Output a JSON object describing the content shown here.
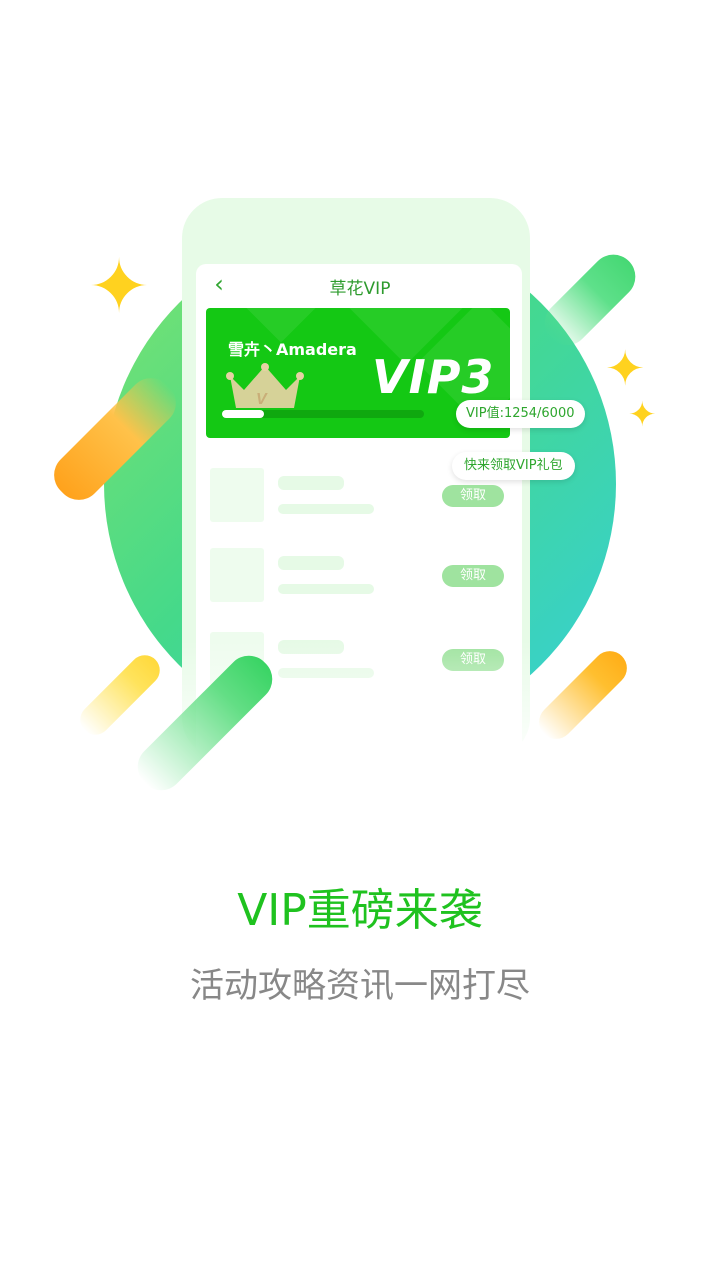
{
  "card": {
    "nav_title": "草花VIP",
    "username": "雪卉丶Amadera",
    "vip_level": "VIP3",
    "vip_value_label": "VIP值:1254/6000",
    "vip_progress": 0.21,
    "gift_prompt": "快来领取VIP礼包"
  },
  "list": {
    "claim_labels": [
      "领取",
      "领取",
      "领取"
    ]
  },
  "promo": {
    "headline": "VIP重磅来袭",
    "subline": "活动攻略资讯一网打尽"
  },
  "icons": {
    "back": "chevron-left-icon",
    "sparkle": "sparkle-icon",
    "crown": "crown-icon"
  },
  "colors": {
    "brand_green": "#1fc21f",
    "card_green": "#14c814",
    "accent_yellow": "#ffd21f",
    "accent_orange": "#ffa21c",
    "circle_teal": "#35cfd8"
  }
}
